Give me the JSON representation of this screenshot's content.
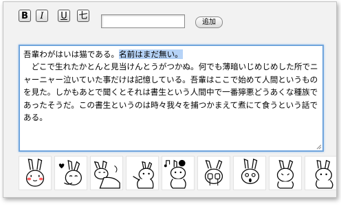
{
  "toolbar": {
    "bold_label": "B",
    "italic_label": "I",
    "underline_label": "U",
    "strike_label": "七",
    "name_input_value": "",
    "add_button_label": "追加"
  },
  "editor": {
    "line1_plain": "吾輩わがはいは猫である。",
    "line1_selected": "名前はまだ無い。",
    "paragraph2": "　どこで生れたかとんと見当けんとうがつかぬ。何でも薄暗いじめじめした所でニャーニャー泣いていた事だけは記憶している。吾輩はここで始めて人間というものを見た。しかもあとで聞くとそれは書生という人間中で一番獰悪どうあくな種族であったそうだ。この書生というのは時々我々を捕つかまえて煮にて食うという話である。"
  },
  "stickers": [
    {
      "icon": "rabbit-blush-icon"
    },
    {
      "icon": "rabbit-heart-icon"
    },
    {
      "icon": "rabbit-lying-icon"
    },
    {
      "icon": "rabbit-wave-icon"
    },
    {
      "icon": "rabbit-music-icon"
    },
    {
      "icon": "rabbit-cry-icon"
    },
    {
      "icon": "rabbit-surprised-icon"
    },
    {
      "icon": "rabbit-scared-icon"
    },
    {
      "icon": "rabbit-peek-icon"
    }
  ]
}
